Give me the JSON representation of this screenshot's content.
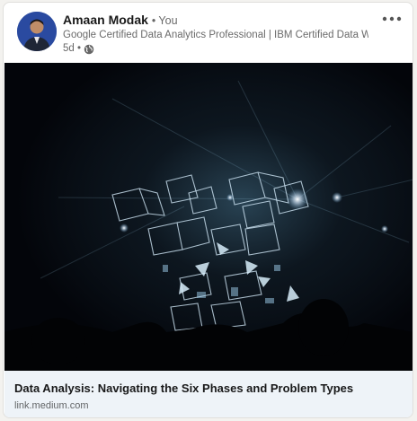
{
  "post": {
    "author_name": "Amaan Modak",
    "author_tag": "• You",
    "headline": "Google Certified Data Analytics Professional | IBM Certified Data W...",
    "time": "5d •",
    "visibility_icon": "globe-icon",
    "menu_icon": "more-horizontal-icon"
  },
  "link": {
    "title": "Data Analysis: Navigating the Six Phases and Problem Types",
    "domain": "link.medium.com"
  },
  "colors": {
    "avatar_bg": "#2b4d9c",
    "link_bar_bg": "#eef3f8",
    "image_bg": "#05070b",
    "light_blue": "#bfe3ff"
  }
}
